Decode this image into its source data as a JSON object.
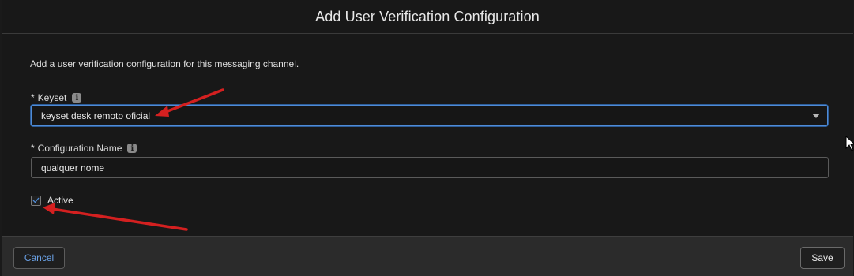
{
  "modal": {
    "title": "Add User Verification Configuration",
    "description": "Add a user verification configuration for this messaging channel."
  },
  "fields": {
    "keyset": {
      "required_mark": "*",
      "label": "Keyset",
      "value": "keyset desk remoto oficial"
    },
    "configuration_name": {
      "required_mark": "*",
      "label": "Configuration Name",
      "value": "qualquer nome"
    },
    "active": {
      "label": "Active",
      "checked": true
    }
  },
  "footer": {
    "cancel_label": "Cancel",
    "save_label": "Save"
  },
  "icons": {
    "info": "info-icon",
    "caret": "chevron-down-icon",
    "check": "check-icon",
    "cursor": "mouse-pointer-icon"
  },
  "colors": {
    "accent": "#4f8bd6",
    "annotation_arrow": "#d42020",
    "background": "#181818",
    "footer": "#2b2b2b"
  }
}
